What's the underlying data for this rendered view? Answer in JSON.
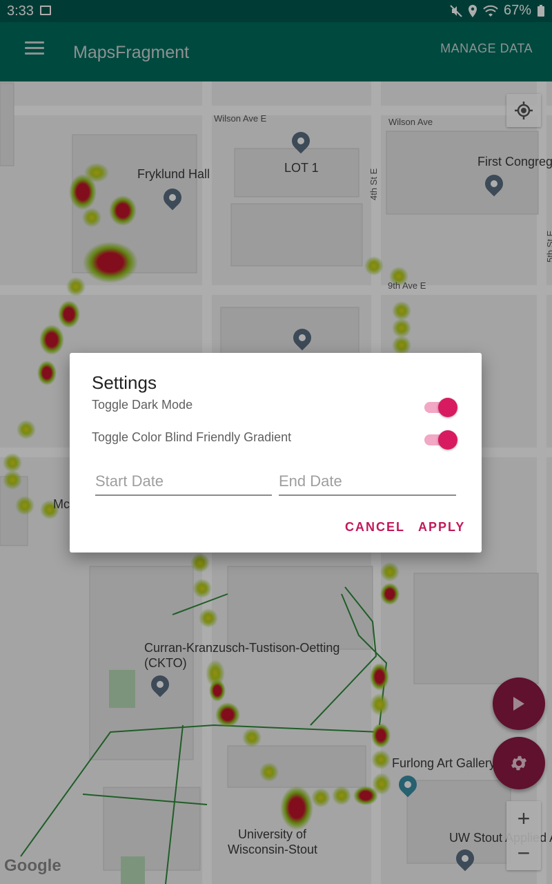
{
  "status_bar": {
    "time": "3:33",
    "battery": "67%"
  },
  "app_bar": {
    "title": "MapsFragment",
    "manage_data": "MANAGE DATA"
  },
  "map": {
    "labels": {
      "wilson_ave_1": "Wilson Ave E",
      "wilson_ave_2": "Wilson Ave",
      "fryklund_hall": "Fryklund Hall",
      "lot1": "LOT 1",
      "first_congregational": "First Congrega",
      "fourth_st": "4th St E",
      "ninth_ave": "9th Ave E",
      "fifth_st": "5th St E",
      "mc": "Mc",
      "ckto_line1": "Curran-Kranzusch-Tustison-Oetting",
      "ckto_line2": "(CKTO)",
      "furlong": "Furlong Art Gallery",
      "uw_stout_line1": "University of",
      "uw_stout_line2": "Wisconsin-Stout",
      "uw_applied": "UW Stout Applied A"
    },
    "google": "Google",
    "zoom_in": "+",
    "zoom_out": "−"
  },
  "dialog": {
    "title": "Settings",
    "dark_mode_label": "Toggle Dark Mode",
    "dark_mode_on": true,
    "colorblind_label": "Toggle Color Blind Friendly Gradient",
    "colorblind_on": true,
    "start_date_placeholder": "Start Date",
    "end_date_placeholder": "End Date",
    "cancel": "CANCEL",
    "apply": "APPLY"
  },
  "colors": {
    "accent": "#d81b60",
    "primary": "#006c5e",
    "fab": "#8c1a45"
  }
}
